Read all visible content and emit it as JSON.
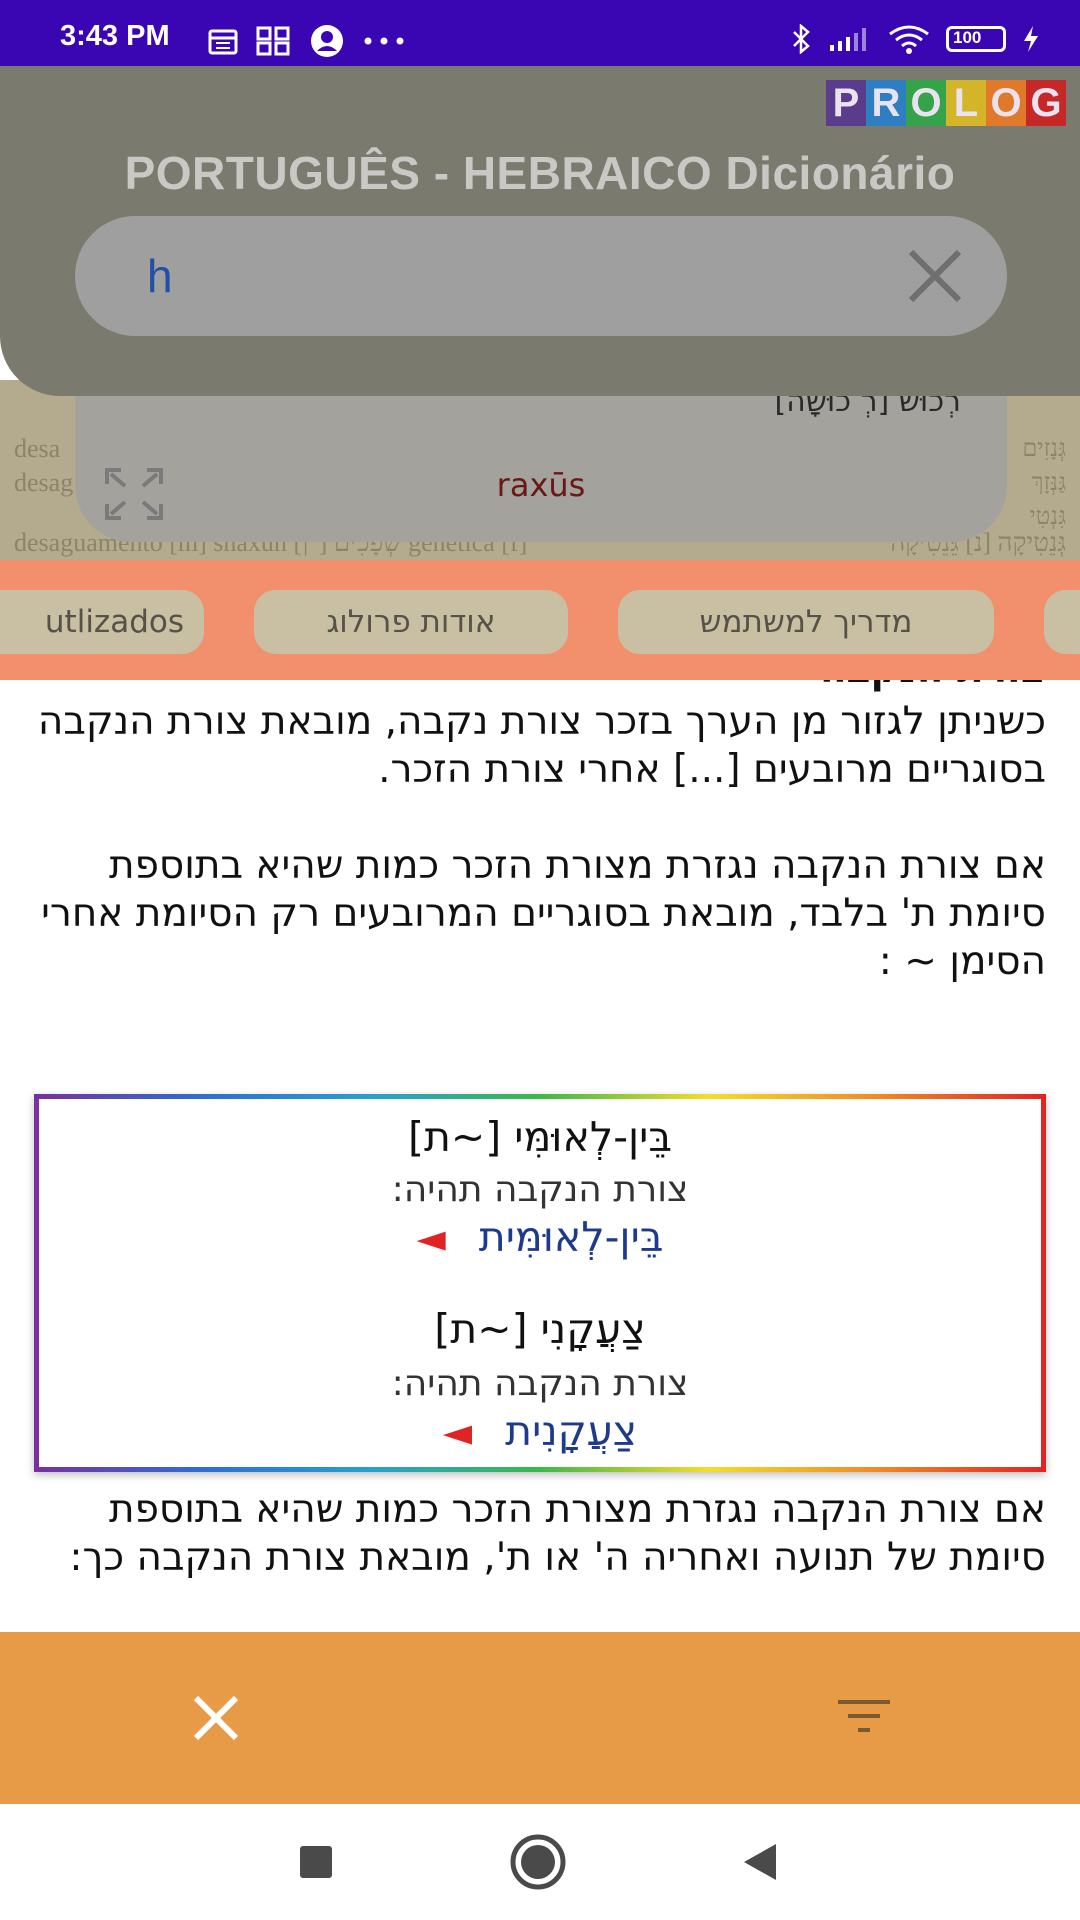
{
  "status_bar": {
    "time": "3:43 PM",
    "battery": "100",
    "icons_left": [
      "calendar-icon",
      "grid-app-icon",
      "account-circle-icon",
      "more-dots-icon"
    ],
    "icons_right": [
      "bluetooth-icon",
      "signal-icon",
      "wifi-icon",
      "battery-icon",
      "charging-icon"
    ]
  },
  "header": {
    "logo_letters": [
      "P",
      "R",
      "O",
      "L",
      "O",
      "G"
    ],
    "logo_colors": [
      "#5a3b8c",
      "#2d7fc1",
      "#35a34a",
      "#e8c32a",
      "#e07a2a",
      "#d32f2f"
    ],
    "title": "PORTUGUÊS - HEBRAICO Dicionário",
    "search_value": "h"
  },
  "background_page": {
    "left_lines": [
      "desa",
      "desag"
    ],
    "left_bottom": "desaguamento [m] shaxun [־ן] שְׁפָכִים   genetica [f]",
    "right_lines": [
      "גְּנָזִים",
      "גַּנְּזָךְ",
      "גִּנְטִי"
    ],
    "right_bottom": "גְּנֵטִיקָה [נ] גֵּנֵטִיקָה"
  },
  "entry_card": {
    "hebrew": "[רְכוּשׁ [רְ כוּשָׁה",
    "transliteration": "raxūs"
  },
  "tabs": [
    {
      "label": "utlizados"
    },
    {
      "label": "אודות פרולוג"
    },
    {
      "label": "מדריך למשתמש"
    },
    {
      "label": ""
    }
  ],
  "content": {
    "heading_partial": "צורת הנקבה",
    "para1": "כשניתן לגזור מן הערך בזכר צורת נקבה, מובאת צורת הנקבה בסוגריים מרובעים [...] אחרי צורת הזכר.",
    "para2": "אם צורת הנקבה נגזרת מצורת הזכר כמות שהיא בתוספת סיומת ת' בלבד, מובאת בסוגריים המרובעים רק הסיומת אחרי הסימן ~ :",
    "examples": [
      {
        "word": "בֵּין-לְאוּמִּי [~ת]",
        "note": "צורת הנקבה תהיה:",
        "result": "בֵּין-לְאוּמִּית",
        "arrow": "◄"
      },
      {
        "word": "צַעֲקָנִי [~ת]",
        "note": "צורת הנקבה תהיה:",
        "result": "צַעֲקָנִית",
        "arrow": "◄"
      }
    ],
    "para3": "אם צורת הנקבה נגזרת מצורת הזכר כמות שהיא בתוספת סיומת של תנועה ואחריה ה' או ת', מובאת צורת הנקבה כך:"
  },
  "action_bar": {
    "close_icon": "close-icon",
    "filter_icon": "filter-icon"
  },
  "nav_bar": {
    "buttons": [
      "recents-square-icon",
      "home-circle-icon",
      "back-triangle-icon"
    ]
  }
}
